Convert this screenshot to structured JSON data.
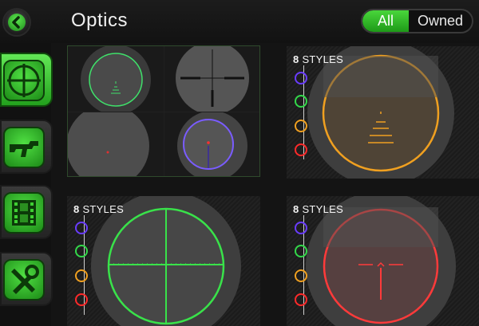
{
  "header": {
    "title": "Optics",
    "filter": {
      "options": [
        "All",
        "Owned"
      ],
      "selected": "All"
    }
  },
  "sidebar": {
    "items": [
      {
        "name": "optics",
        "icon": "crosshair-icon",
        "active": true
      },
      {
        "name": "weapons",
        "icon": "rifle-icon",
        "active": false
      },
      {
        "name": "media",
        "icon": "film-icon",
        "active": false
      },
      {
        "name": "settings",
        "icon": "tools-icon",
        "active": false
      }
    ]
  },
  "cards": [
    {
      "id": "quad",
      "styles_count": null
    },
    {
      "id": "orange",
      "styles_count": "8",
      "styles_label": "STYLES",
      "reticle_color": "#f0a020"
    },
    {
      "id": "green",
      "styles_count": "8",
      "styles_label": "STYLES",
      "reticle_color": "#39e24a"
    },
    {
      "id": "red",
      "styles_count": "8",
      "styles_label": "STYLES",
      "reticle_color": "#ff3a3a"
    }
  ],
  "style_colors": [
    "#6a3cff",
    "#33d94a",
    "#f0a020",
    "#ff2a2a"
  ],
  "colors": {
    "accent": "#3ccf2f",
    "background": "#141414"
  }
}
